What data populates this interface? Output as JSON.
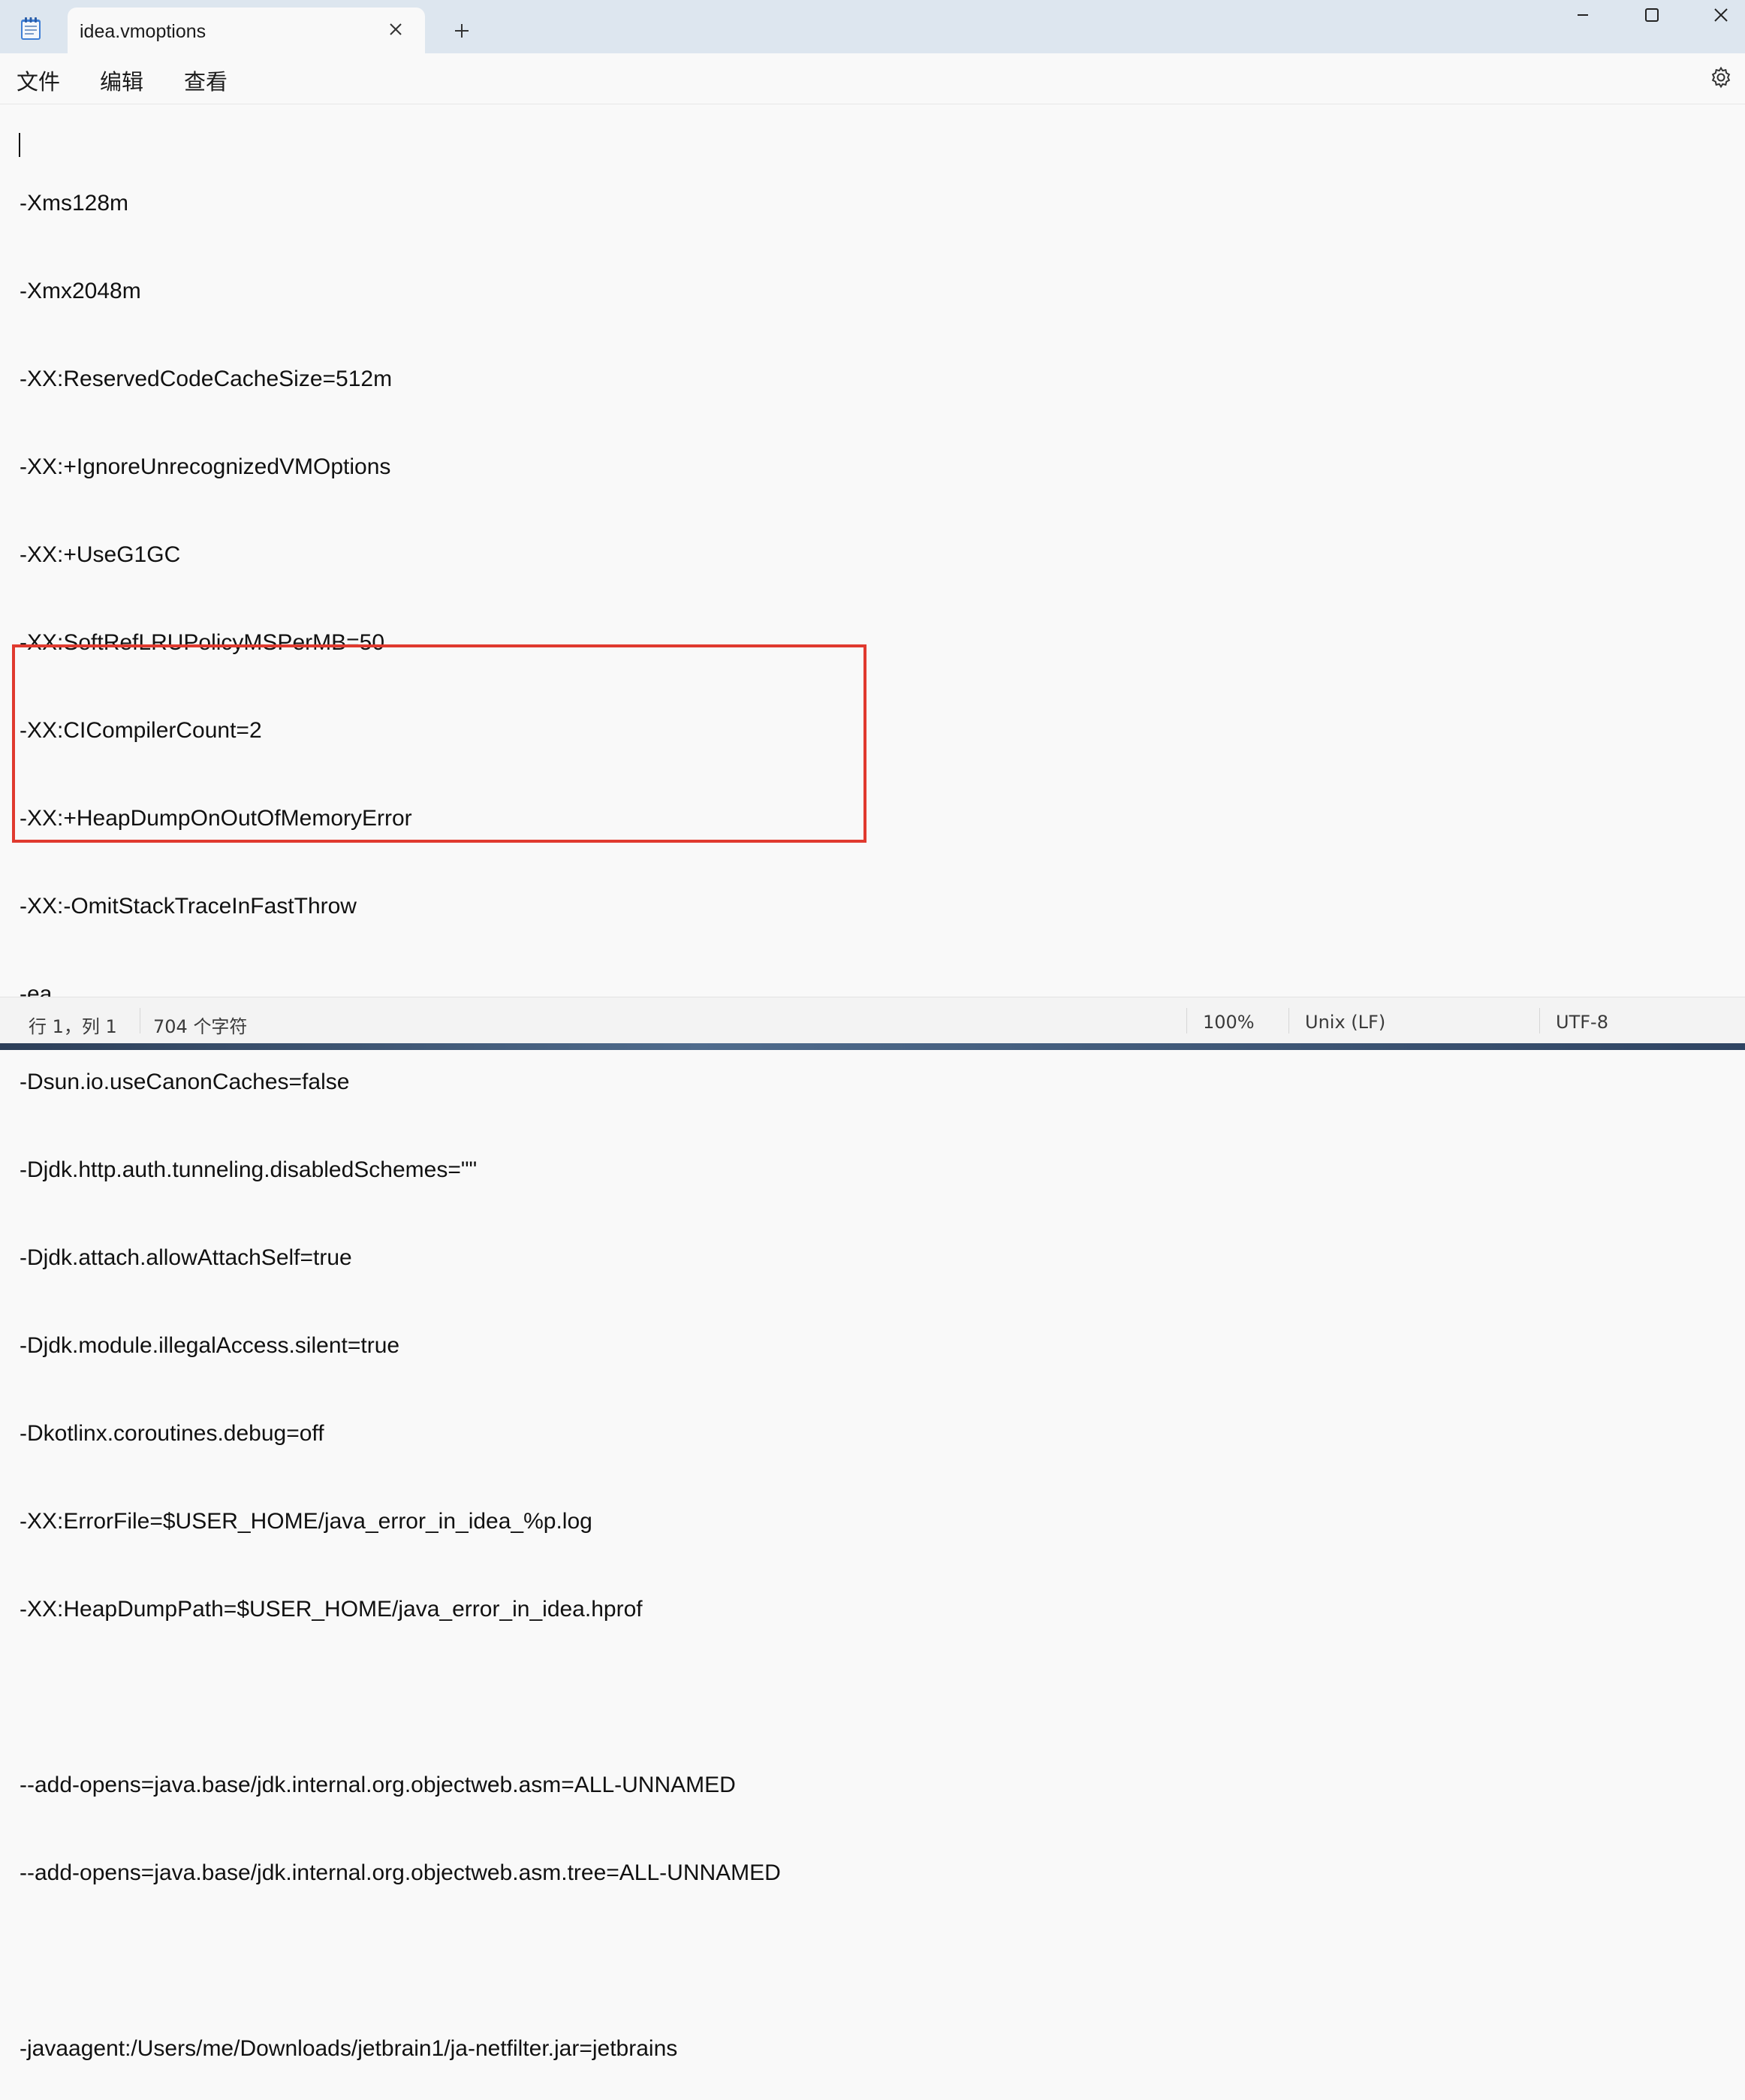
{
  "window": {
    "tab_title": "idea.vmoptions",
    "new_tab_symbol": "+",
    "icons": {
      "app": "notepad-icon",
      "close_tab": "close-icon",
      "minimize": "minimize-icon",
      "maximize": "maximize-icon",
      "close": "close-icon"
    }
  },
  "menu": {
    "file": "文件",
    "edit": "编辑",
    "view": "查看",
    "settings_icon": "gear-icon"
  },
  "editor": {
    "lines": [
      "-Xms128m",
      "-Xmx2048m",
      "-XX:ReservedCodeCacheSize=512m",
      "-XX:+IgnoreUnrecognizedVMOptions",
      "-XX:+UseG1GC",
      "-XX:SoftRefLRUPolicyMSPerMB=50",
      "-XX:CICompilerCount=2",
      "-XX:+HeapDumpOnOutOfMemoryError",
      "-XX:-OmitStackTraceInFastThrow",
      "-ea",
      "-Dsun.io.useCanonCaches=false",
      "-Djdk.http.auth.tunneling.disabledSchemes=\"\"",
      "-Djdk.attach.allowAttachSelf=true",
      "-Djdk.module.illegalAccess.silent=true",
      "-Dkotlinx.coroutines.debug=off",
      "-XX:ErrorFile=$USER_HOME/java_error_in_idea_%p.log",
      "-XX:HeapDumpPath=$USER_HOME/java_error_in_idea.hprof",
      "",
      "--add-opens=java.base/jdk.internal.org.objectweb.asm=ALL-UNNAMED",
      "--add-opens=java.base/jdk.internal.org.objectweb.asm.tree=ALL-UNNAMED",
      "",
      "-javaagent:/Users/me/Downloads/jetbrain1/ja-netfilter.jar=jetbrains"
    ],
    "highlight_color": "#e03a2f"
  },
  "status": {
    "position": "行 1，列 1",
    "char_count": "704 个字符",
    "zoom": "100%",
    "line_ending": "Unix (LF)",
    "encoding": "UTF-8"
  }
}
